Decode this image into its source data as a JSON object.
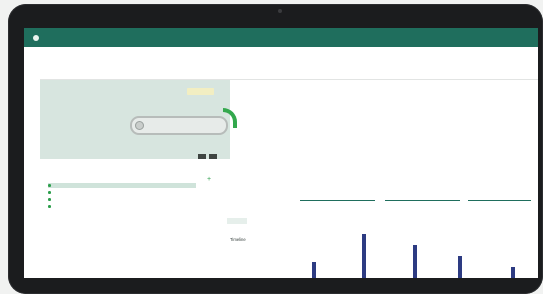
{
  "nav": {
    "logo_small": "",
    "logo": "",
    "links": [
      "",
      ""
    ]
  },
  "page": {
    "title": ""
  },
  "summary": {
    "left_label_1": "",
    "left_value_1": "",
    "left_label_2": "",
    "left_value_2": "",
    "status_badge": "",
    "mini_labels": [
      "",
      ""
    ],
    "fields": [
      {
        "label": "",
        "value": ""
      },
      {
        "label": "",
        "value": ""
      },
      {
        "label": "",
        "value": ""
      },
      {
        "label": "",
        "value": ""
      },
      {
        "label": "",
        "value": ""
      },
      {
        "label": "",
        "value": ""
      }
    ]
  },
  "list": {
    "header": "",
    "items": [
      {
        "label": "",
        "selected": true
      },
      {
        "label": "",
        "selected": false
      },
      {
        "label": "",
        "selected": false
      },
      {
        "label": "",
        "selected": false
      }
    ]
  },
  "detail": {
    "status_label": "",
    "status_value": "",
    "fields": [
      {
        "label": "",
        "value": ""
      },
      {
        "label": "",
        "value": ""
      },
      {
        "label": "",
        "value": ""
      },
      {
        "label": "",
        "value": ""
      },
      {
        "label": "",
        "value": ""
      },
      {
        "label": "",
        "value": ""
      }
    ]
  },
  "chart": {
    "tabs": [
      "",
      ""
    ],
    "title": "Timeline",
    "bar_color": "#2d3b82"
  },
  "colors": {
    "brand": "#1f6e5d",
    "accent_green": "#2c9e4b",
    "panel_tint": "#d7e5df"
  }
}
